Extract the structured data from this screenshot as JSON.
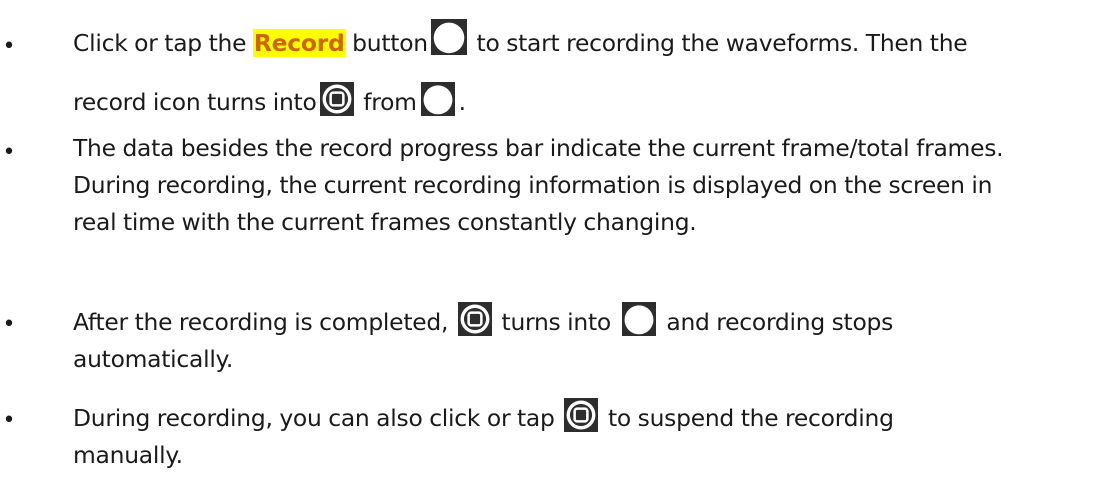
{
  "items": [
    {
      "line1": {
        "a": "Click or tap the ",
        "highlight": "Record",
        "b": " button",
        "c": " to start recording the waveforms. Then the"
      },
      "line2": {
        "a": "record icon turns into",
        "b": " from",
        "c": "."
      },
      "icons": [
        "record-start-icon",
        "record-stop-icon",
        "record-start-icon"
      ]
    },
    {
      "lines": [
        "The data besides the record progress bar indicate the current frame/total frames.",
        "During recording, the current recording information is displayed on the screen in",
        "real time with the current frames constantly changing."
      ]
    },
    {
      "line1": {
        "a": "After the recording is completed, ",
        "b": " turns into ",
        "c": " and recording stops"
      },
      "line2": "automatically.",
      "icons": [
        "record-stop-icon",
        "record-start-icon"
      ]
    },
    {
      "line1": {
        "a": "During recording, you can also click or tap ",
        "b": " to suspend the recording"
      },
      "line2": "manually.",
      "icons": [
        "record-stop-icon"
      ]
    }
  ],
  "bullet_glyph": "•",
  "colors": {
    "highlight_bg": "#ffff00",
    "highlight_text": "#cc6600",
    "icon_bg": "#2d2d2d",
    "icon_fg": "#ffffff"
  }
}
